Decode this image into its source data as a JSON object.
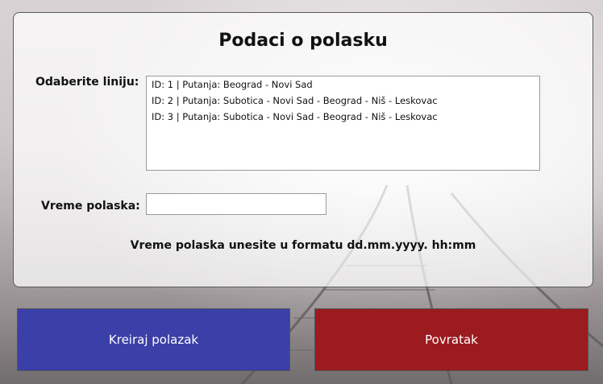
{
  "form": {
    "title": "Podaci o polasku",
    "line_label": "Odaberite liniju:",
    "lines": [
      "ID: 1 | Putanja: Beograd - Novi Sad",
      "ID: 2 | Putanja: Subotica - Novi Sad - Beograd - Niš - Leskovac",
      "ID: 3 | Putanja: Subotica - Novi Sad - Beograd - Niš - Leskovac"
    ],
    "time_label": "Vreme polaska:",
    "time_value": "",
    "hint": "Vreme polaska unesite u formatu dd.mm.yyyy. hh:mm"
  },
  "buttons": {
    "create_label": "Kreiraj polazak",
    "back_label": "Povratak"
  },
  "colors": {
    "create_bg": "#3b3fa8",
    "back_bg": "#9b1b1e"
  }
}
